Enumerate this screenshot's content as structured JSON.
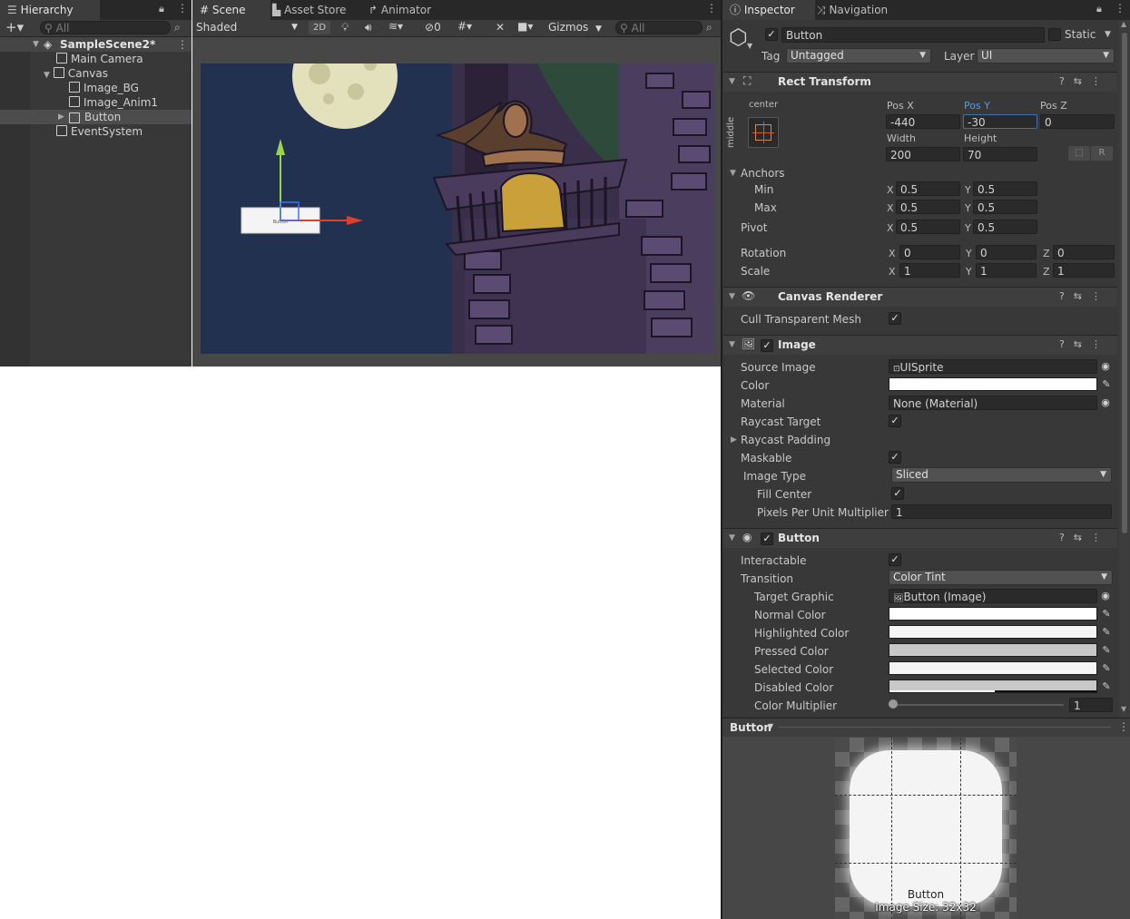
{
  "hierarchy": {
    "tab": "Hierarchy",
    "search_placeholder": "All",
    "scene": "SampleScene2*",
    "items": [
      "Main Camera",
      "Canvas",
      "Image_BG",
      "Image_Anim1",
      "Button",
      "EventSystem"
    ]
  },
  "scene_view": {
    "tabs": [
      "Scene",
      "Asset Store",
      "Animator"
    ],
    "shading": "Shaded",
    "mode_2d": "2D",
    "hidden_count": "0",
    "gizmos": "Gizmos",
    "search_placeholder": "All",
    "button_text": "Button"
  },
  "inspector": {
    "tabs": [
      "Inspector",
      "Navigation"
    ],
    "object_name": "Button",
    "static_label": "Static",
    "tag_label": "Tag",
    "tag_value": "Untagged",
    "layer_label": "Layer",
    "layer_value": "UI",
    "rect_transform": {
      "title": "Rect Transform",
      "anchor_h": "center",
      "anchor_v": "middle",
      "pos_x_label": "Pos X",
      "pos_x": "-440",
      "pos_y_label": "Pos Y",
      "pos_y": "-30",
      "pos_z_label": "Pos Z",
      "pos_z": "0",
      "width_label": "Width",
      "width": "200",
      "height_label": "Height",
      "height": "70",
      "r_label": "R",
      "anchors_label": "Anchors",
      "min_label": "Min",
      "min_x": "0.5",
      "min_y": "0.5",
      "max_label": "Max",
      "max_x": "0.5",
      "max_y": "0.5",
      "pivot_label": "Pivot",
      "pivot_x": "0.5",
      "pivot_y": "0.5",
      "rotation_label": "Rotation",
      "rot_x": "0",
      "rot_y": "0",
      "rot_z": "0",
      "scale_label": "Scale",
      "scale_x": "1",
      "scale_y": "1",
      "scale_z": "1",
      "x": "X",
      "y": "Y",
      "z": "Z"
    },
    "canvas_renderer": {
      "title": "Canvas Renderer",
      "cull_label": "Cull Transparent Mesh"
    },
    "image": {
      "title": "Image",
      "source_image_label": "Source Image",
      "source_image": "UISprite",
      "color_label": "Color",
      "material_label": "Material",
      "material": "None (Material)",
      "raycast_target_label": "Raycast Target",
      "raycast_padding_label": "Raycast Padding",
      "maskable_label": "Maskable",
      "image_type_label": "Image Type",
      "image_type": "Sliced",
      "fill_center_label": "Fill Center",
      "ppu_label": "Pixels Per Unit Multiplier",
      "ppu": "1"
    },
    "button": {
      "title": "Button",
      "interactable_label": "Interactable",
      "transition_label": "Transition",
      "transition": "Color Tint",
      "target_graphic_label": "Target Graphic",
      "target_graphic": "Button (Image)",
      "normal_label": "Normal Color",
      "highlighted_label": "Highlighted Color",
      "pressed_label": "Pressed Color",
      "selected_label": "Selected Color",
      "disabled_label": "Disabled Color",
      "multiplier_label": "Color Multiplier",
      "multiplier": "1"
    },
    "preview": {
      "title": "Button",
      "caption_name": "Button",
      "caption_size": "Image Size: 32x32"
    }
  },
  "colors": {
    "scene_bg": "#233150",
    "accent_blue": "#3a72b0",
    "selection": "#4d4d4d",
    "pressed_color": "#c8c8c8",
    "disabled_color": "#c8c8c8"
  }
}
